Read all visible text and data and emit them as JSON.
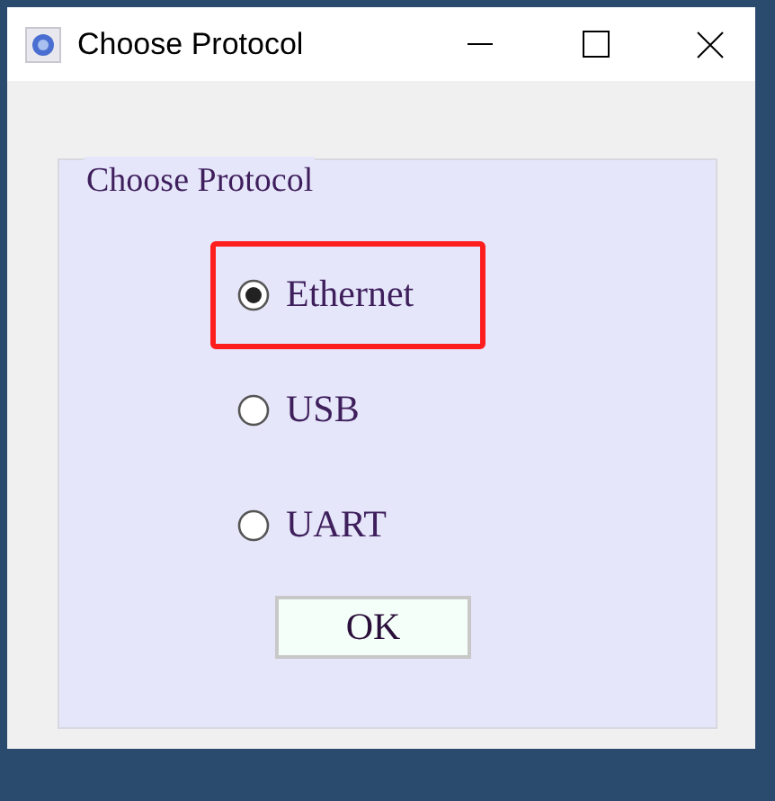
{
  "window": {
    "title": "Choose Protocol"
  },
  "group": {
    "legend": "Choose Protocol"
  },
  "options": [
    {
      "label": "Ethernet",
      "selected": true,
      "highlighted": true
    },
    {
      "label": "USB",
      "selected": false,
      "highlighted": false
    },
    {
      "label": "UART",
      "selected": false,
      "highlighted": false
    }
  ],
  "buttons": [
    "OK"
  ]
}
